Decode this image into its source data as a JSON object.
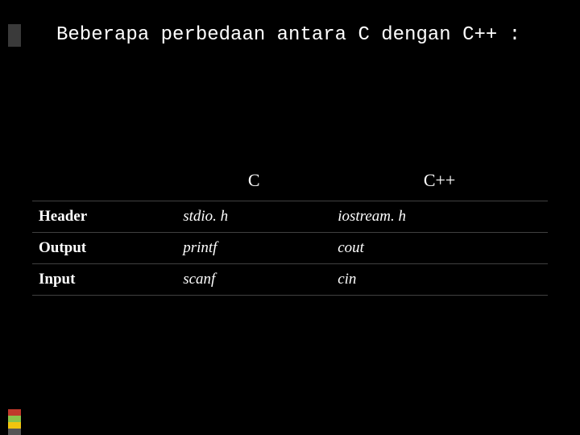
{
  "title": "Beberapa perbedaan antara C dengan C++ :",
  "table": {
    "headers": {
      "blank": "",
      "c": "C",
      "cpp": "C++"
    },
    "rows": [
      {
        "label": "Header",
        "c": "stdio. h",
        "cpp": "iostream. h"
      },
      {
        "label": "Output",
        "c": "printf",
        "cpp": "cout"
      },
      {
        "label": "Input",
        "c": "scanf",
        "cpp": "cin"
      }
    ]
  },
  "accent_colors": {
    "top": "#3a3a3a",
    "segments": [
      "#c0392b",
      "#8bc34a",
      "#f1c40f",
      "#555555"
    ]
  }
}
